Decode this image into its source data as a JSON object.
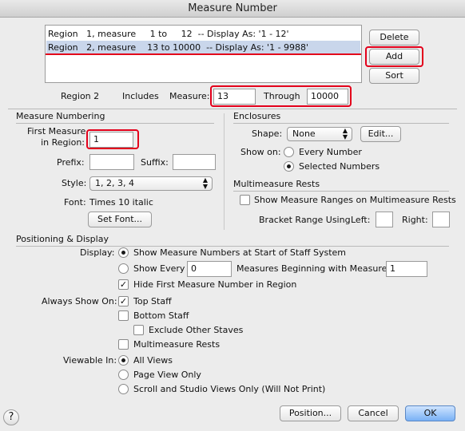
{
  "window": {
    "title": "Measure Number"
  },
  "regions_list": {
    "rows": [
      {
        "text": "Region   1, measure     1 to     12  -- Display As: '1 - 12'"
      },
      {
        "text": "Region   2, measure    13 to 10000  -- Display As: '1 - 9988'"
      }
    ]
  },
  "buttons": {
    "delete": "Delete",
    "add": "Add",
    "sort": "Sort",
    "position": "Position...",
    "cancel": "Cancel",
    "ok": "OK",
    "edit": "Edit...",
    "set_font": "Set Font...",
    "help": "?"
  },
  "region_bar": {
    "region_label": "Region 2",
    "includes_label": "Includes",
    "measure_label": "Measure:",
    "measure_value": "13",
    "through_label": "Through",
    "through_value": "10000"
  },
  "measure_numbering": {
    "section_title": "Measure Numbering",
    "first_measure_label_line1": "First Measure",
    "first_measure_label_line2": "in Region:",
    "first_measure_value": "1",
    "prefix_label": "Prefix:",
    "prefix_value": "",
    "suffix_label": "Suffix:",
    "suffix_value": "",
    "style_label": "Style:",
    "style_value": "1, 2, 3, 4",
    "font_label": "Font:",
    "font_value": "Times 10 italic"
  },
  "enclosures": {
    "section_title": "Enclosures",
    "shape_label": "Shape:",
    "shape_value": "None",
    "show_on_label": "Show on:",
    "every_number": "Every Number",
    "selected_numbers": "Selected Numbers"
  },
  "multimeasure": {
    "section_title": "Multimeasure Rests",
    "show_ranges": "Show Measure Ranges on Multimeasure Rests",
    "bracket_label": "Bracket Range Using",
    "left_label": "Left:",
    "right_label": "Right:",
    "left_value": "",
    "right_value": ""
  },
  "positioning": {
    "section_title": "Positioning & Display",
    "display_label": "Display:",
    "show_at_start": "Show Measure Numbers at Start of Staff System",
    "show_every": "Show Every",
    "show_every_value": "0",
    "measures_beginning": "Measures Beginning with Measure",
    "beginning_value": "1",
    "hide_first": "Hide First Measure Number in Region",
    "always_show_label": "Always Show On:",
    "top_staff": "Top Staff",
    "bottom_staff": "Bottom Staff",
    "exclude_other": "Exclude Other Staves",
    "multimeasure_rests": "Multimeasure Rests",
    "viewable_label": "Viewable In:",
    "all_views": "All Views",
    "page_view_only": "Page View Only",
    "scroll_studio": "Scroll and Studio Views Only (Will Not Print)"
  },
  "colors": {
    "highlight": "#e3001b",
    "selection": "#c9d6eb",
    "default_button": "#79b1f5"
  }
}
